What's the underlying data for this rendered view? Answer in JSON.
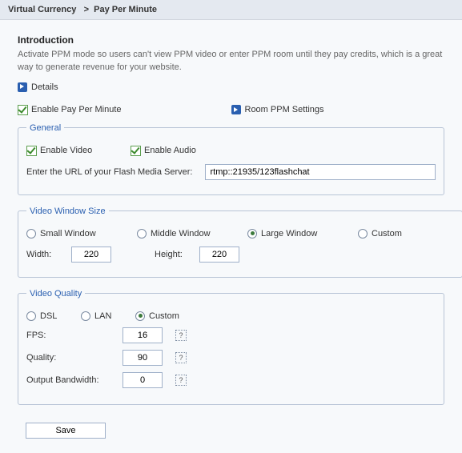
{
  "breadcrumb": {
    "section": "Virtual Currency",
    "sep": ">",
    "page": "Pay Per Minute"
  },
  "intro": {
    "title": "Introduction",
    "text": "Activate PPM mode so users can't view PPM video or enter PPM room until they pay credits, which is a great way to generate revenue for your website."
  },
  "details_label": "Details",
  "enable_ppm_label": "Enable Pay Per Minute",
  "room_ppm_label": "Room PPM Settings",
  "general": {
    "legend": "General",
    "enable_video": "Enable Video",
    "enable_audio": "Enable Audio",
    "url_label": "Enter the URL of your Flash Media Server:",
    "url_value": "rtmp::21935/123flashchat"
  },
  "window_size": {
    "legend": "Video Window Size",
    "options": {
      "small": "Small Window",
      "middle": "Middle Window",
      "large": "Large Window",
      "custom": "Custom"
    },
    "width_label": "Width:",
    "width_value": "220",
    "height_label": "Height:",
    "height_value": "220"
  },
  "quality": {
    "legend": "Video Quality",
    "options": {
      "dsl": "DSL",
      "lan": "LAN",
      "custom": "Custom"
    },
    "fps_label": "FPS:",
    "fps_value": "16",
    "quality_label": "Quality:",
    "quality_value": "90",
    "bandwidth_label": "Output Bandwidth:",
    "bandwidth_value": "0",
    "help": "?"
  },
  "save_label": "Save"
}
